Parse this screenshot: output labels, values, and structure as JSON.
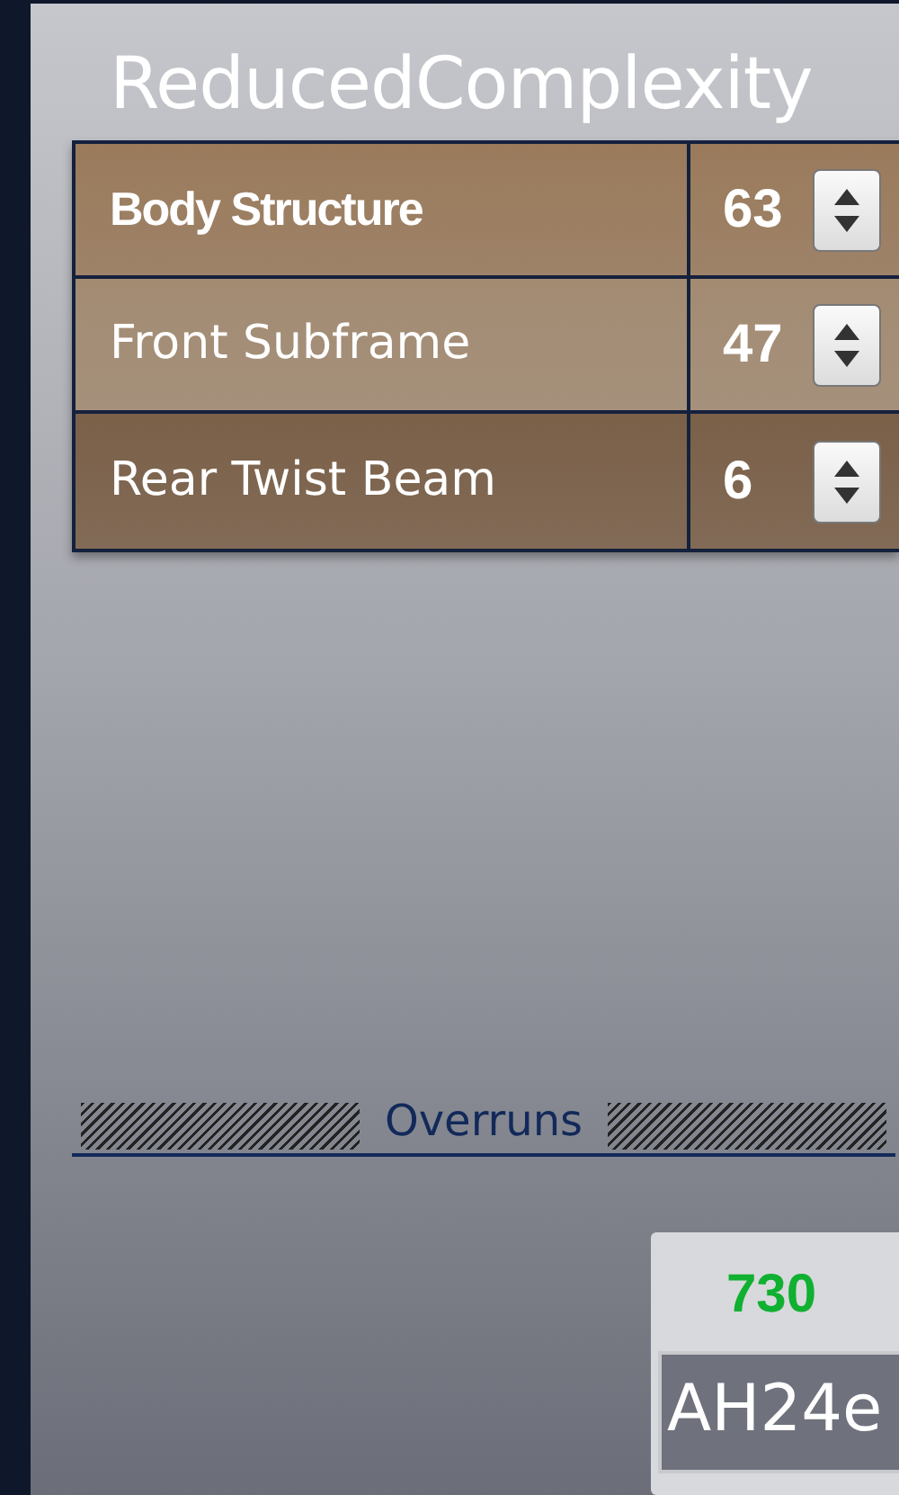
{
  "title": "ReducedComplexity",
  "rows": [
    {
      "name": "Body Structure",
      "value": "63",
      "selected": true
    },
    {
      "name": "Front Subframe",
      "value": "47",
      "selected": false
    },
    {
      "name": "Rear Twist Beam",
      "value": "6",
      "selected": false
    }
  ],
  "section": {
    "label": "Overruns"
  },
  "tile": {
    "count": "730",
    "code": "AH24e"
  }
}
